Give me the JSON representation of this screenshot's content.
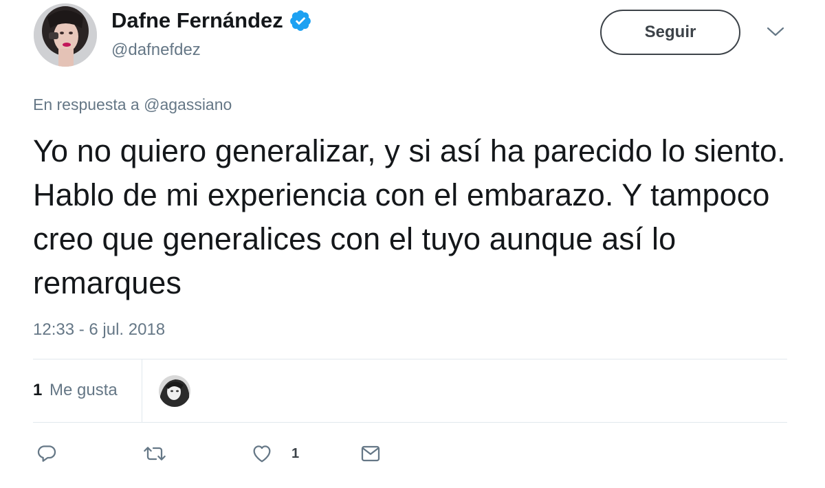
{
  "author": {
    "display_name": "Dafne Fernández",
    "handle": "@dafnefdez",
    "verified_icon": "verified-badge-icon"
  },
  "header": {
    "follow_label": "Seguir",
    "menu_icon": "chevron-down-icon"
  },
  "reply_context": "En respuesta a @agassiano",
  "tweet": {
    "text": "Yo no quiero generalizar, y si así ha parecido lo siento. Hablo de mi experiencia con el embarazo. Y tampoco creo que generalices con el tuyo aunque así lo remarques",
    "timestamp": "12:33 - 6 jul. 2018"
  },
  "stats": {
    "likes_count": "1",
    "likes_label": "Me gusta"
  },
  "actions": {
    "reply_icon": "reply-icon",
    "retweet_icon": "retweet-icon",
    "like_icon": "heart-icon",
    "like_count": "1",
    "dm_icon": "envelope-icon"
  },
  "colors": {
    "verified_blue": "#1da1f2",
    "secondary_text": "#657786",
    "primary_text": "#14171a",
    "icon_gray": "#657786"
  }
}
